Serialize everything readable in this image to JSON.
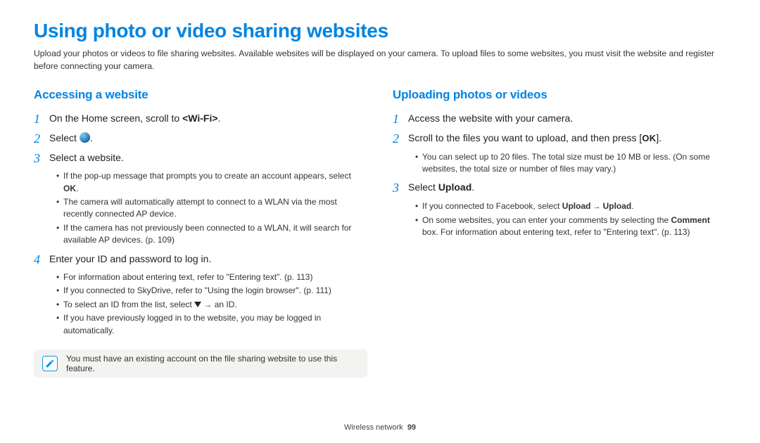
{
  "title": "Using photo or video sharing websites",
  "intro": "Upload your photos or videos to file sharing websites. Available websites will be displayed on your camera. To upload files to some websites, you must visit the website and register before connecting your camera.",
  "left": {
    "heading": "Accessing a website",
    "step1_pre": "On the Home screen, scroll to ",
    "step1_bold": "<Wi-Fi>",
    "step1_post": ".",
    "step2_pre": "Select ",
    "step2_post": ".",
    "step3": "Select a website.",
    "step3_b1_pre": "If the pop-up message that prompts you to create an account appears, select ",
    "step3_b1_bold": "OK",
    "step3_b1_post": ".",
    "step3_b2": "The camera will automatically attempt to connect to a WLAN via the most recently connected AP device.",
    "step3_b3": "If the camera has not previously been connected to a WLAN, it will search for available AP devices. (p. 109)",
    "step4": "Enter your ID and password to log in.",
    "step4_b1": "For information about entering text, refer to \"Entering text\". (p. 113)",
    "step4_b2": "If you connected to SkyDrive, refer to \"Using the login browser\". (p. 111)",
    "step4_b3_pre": "To select an ID from the list, select ",
    "step4_b3_post": " → an ID.",
    "step4_b4": "If you have previously logged in to the website, you may be logged in automatically.",
    "note": "You must have an existing account on the file sharing website to use this feature."
  },
  "right": {
    "heading": "Uploading photos or videos",
    "step1": "Access the website with your camera.",
    "step2_pre": "Scroll to the files you want to upload, and then press [",
    "step2_ok": "OK",
    "step2_post": "].",
    "step2_b1": "You can select up to 20 files. The total size must be 10 MB or less. (On some websites, the total size or number of files may vary.)",
    "step3_pre": "Select ",
    "step3_bold": "Upload",
    "step3_post": ".",
    "step3_b1_pre": "If you connected to Facebook, select ",
    "step3_b1_bold1": "Upload",
    "step3_b1_arrow": " → ",
    "step3_b1_bold2": "Upload",
    "step3_b1_post": ".",
    "step3_b2_pre": "On some websites, you can enter your comments by selecting the ",
    "step3_b2_bold": "Comment",
    "step3_b2_post": " box. For information about entering text, refer to \"Entering text\". (p. 113)"
  },
  "footer_label": "Wireless network",
  "footer_page": "99"
}
